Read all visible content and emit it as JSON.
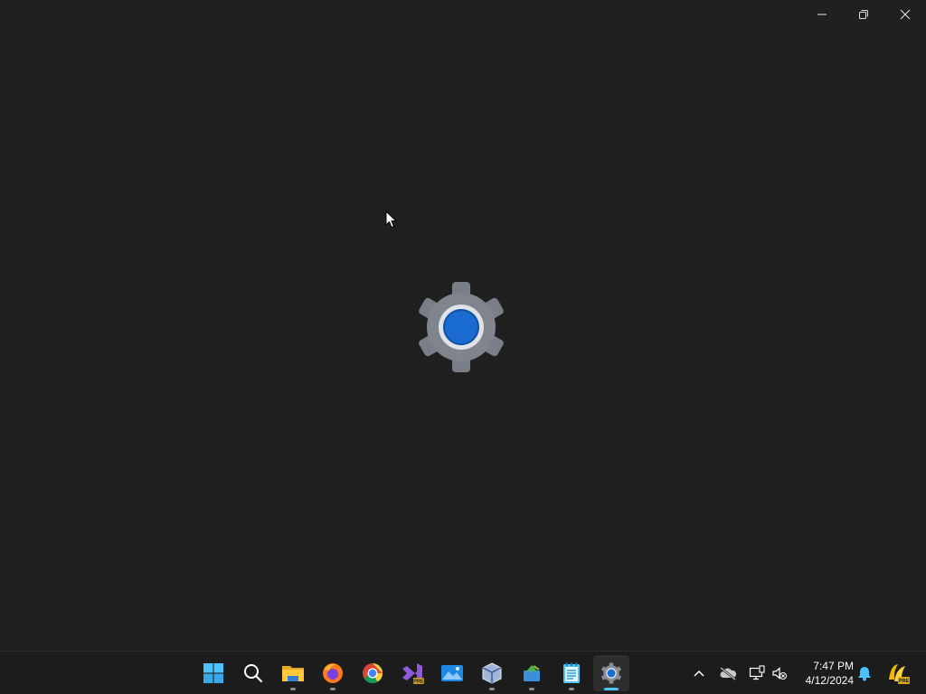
{
  "window": {
    "caption_buttons": [
      {
        "name": "minimize",
        "icon": "minimize-icon"
      },
      {
        "name": "restore",
        "icon": "restore-icon"
      },
      {
        "name": "close",
        "icon": "close-icon"
      }
    ],
    "splash_icon": "settings-gear-icon"
  },
  "taskbar": {
    "apps": [
      {
        "name": "start",
        "icon": "windows-logo-icon"
      },
      {
        "name": "search",
        "icon": "search-icon"
      },
      {
        "name": "file-explorer",
        "icon": "folder-icon"
      },
      {
        "name": "firefox",
        "icon": "firefox-icon"
      },
      {
        "name": "chrome",
        "icon": "chrome-icon"
      },
      {
        "name": "visual-studio-preview",
        "icon": "visual-studio-icon",
        "badge": "PRE"
      },
      {
        "name": "photos",
        "icon": "photos-icon"
      },
      {
        "name": "virtualbox",
        "icon": "virtualbox-icon"
      },
      {
        "name": "app-green",
        "icon": "app-icon"
      },
      {
        "name": "notepad",
        "icon": "notepad-icon"
      },
      {
        "name": "settings",
        "icon": "settings-icon",
        "active": true
      }
    ],
    "tray": {
      "icons": [
        "chevron-up-icon",
        "onedrive-offline-icon",
        "network-icon",
        "volume-muted-icon",
        "bell-icon",
        "copilot-icon"
      ],
      "copilot_badge": "PRE",
      "time": "7:47 PM",
      "date": "4/12/2024"
    }
  },
  "colors": {
    "background": "#202020",
    "taskbar": "#1c1c1c",
    "accent": "#4cc2ff",
    "gear_blue": "#1a6bd1"
  }
}
